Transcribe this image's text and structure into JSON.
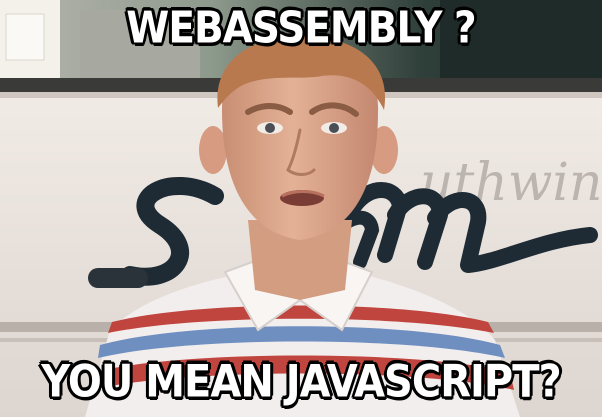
{
  "meme": {
    "top_text": "WEBASSEMBLY ?",
    "bottom_text": "YOU MEAN JAVASCRIPT?"
  },
  "photo": {
    "bus_lettering": "Southwind Storm"
  },
  "colors": {
    "caption_fill": "#ffffff",
    "caption_outline": "#000000",
    "bus_body": "#ebe4de",
    "bus_logo": "#1e2b35",
    "shirt_red": "#c0453e",
    "shirt_blue": "#6f8fc0"
  }
}
